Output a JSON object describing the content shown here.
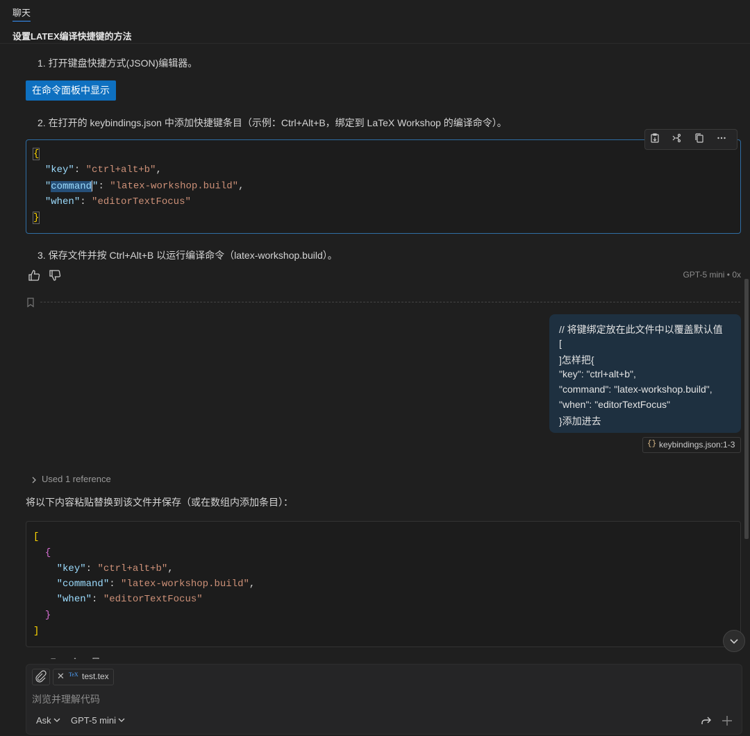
{
  "tab": {
    "label": "聊天"
  },
  "chat_title": "设置LATEX编译快捷键的方法",
  "steps": {
    "step1": "1. 打开键盘快捷方式(JSON)编辑器。",
    "step2": "2. 在打开的 keybindings.json 中添加快捷键条目（示例：Ctrl+Alt+B，绑定到 LaTeX Workshop 的编译命令）。",
    "step3": "3. 保存文件并按 Ctrl+Alt+B 以运行编译命令（latex-workshop.build）。"
  },
  "command_palette_button": "在命令面板中显示",
  "code1": {
    "open_brace": "{",
    "close_brace": "}",
    "k1": "\"key\"",
    "v1": "\"ctrl+alt+b\"",
    "k2_q1": "\"",
    "k2_word": "command",
    "k2_q2": "\"",
    "v2": "\"latex-workshop.build\"",
    "k3": "\"when\"",
    "v3": "\"editorTextFocus\""
  },
  "model_meta": "GPT-5 mini • 0x",
  "user_message": {
    "lines": [
      "// 将键绑定放在此文件中以覆盖默认值",
      "[",
      "]怎样把{",
      "\"key\": \"ctrl+alt+b\",",
      "\"command\": \"latex-workshop.build\",",
      "\"when\": \"editorTextFocus\"",
      "}添加进去"
    ]
  },
  "reference_chip": {
    "icon": "{}",
    "label": "keybindings.json:1-3"
  },
  "used_reference": "Used 1 reference",
  "answer_text": "将以下内容粘贴替换到该文件并保存（或在数组内添加条目）：",
  "code2": {
    "open_bracket": "[",
    "close_bracket": "]",
    "open_brace": "{",
    "close_brace": "}",
    "k1": "\"key\"",
    "v1": "\"ctrl+alt+b\"",
    "k2": "\"command\"",
    "v2": "\"latex-workshop.build\"",
    "k3": "\"when\"",
    "v3": "\"editorTextFocus\""
  },
  "input": {
    "file_chip": "test.tex",
    "tex_badge": "TeX",
    "placeholder": "浏览并理解代码",
    "mode": "Ask",
    "model": "GPT-5 mini"
  },
  "colors": {
    "accent": "#0e70c0",
    "user_bubble": "#1e3040",
    "background": "#1f1f1f"
  }
}
